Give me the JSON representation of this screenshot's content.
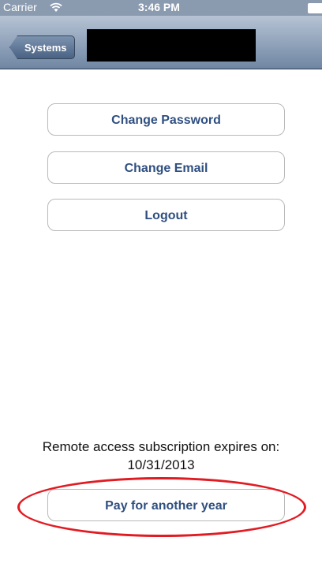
{
  "status_bar": {
    "carrier": "Carrier",
    "time": "3:46 PM",
    "wifi_icon": "wifi-icon",
    "battery_icon": "battery-icon"
  },
  "nav_bar": {
    "back_label": "Systems"
  },
  "account": {
    "change_password_label": "Change Password",
    "change_email_label": "Change Email",
    "logout_label": "Logout"
  },
  "subscription": {
    "expires_label": "Remote access subscription expires on:",
    "expiry_date": "10/31/2013",
    "pay_label": "Pay for another year"
  },
  "colors": {
    "button_text": "#2f4f80",
    "annotation": "#e11b22",
    "nav_bar": "#6f86a3"
  }
}
